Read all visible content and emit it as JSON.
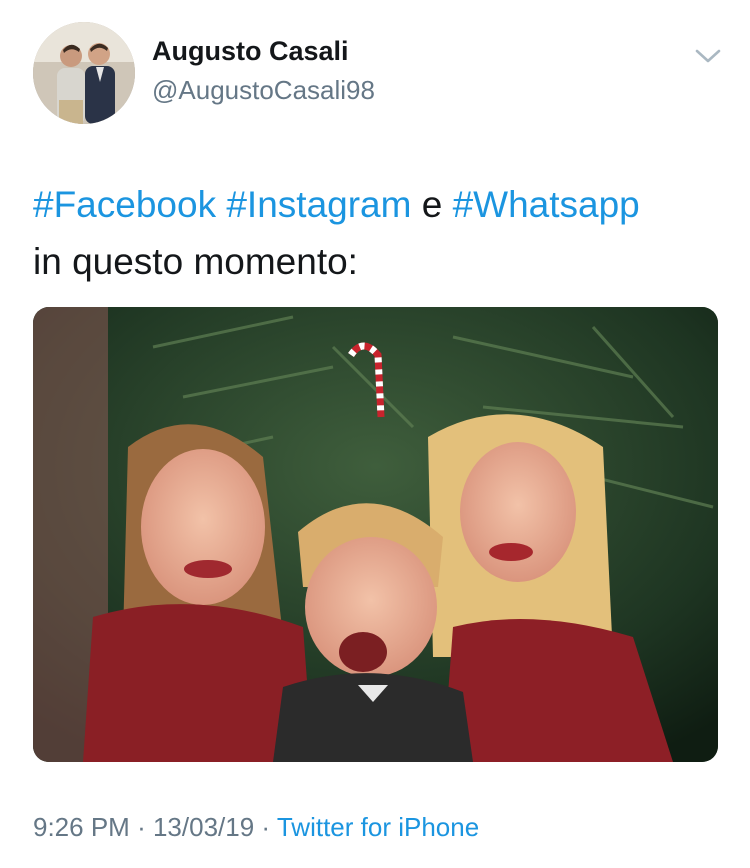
{
  "tweet": {
    "author": {
      "display_name": "Augusto Casali",
      "handle": "@AugustoCasali98"
    },
    "menu_icon": "chevron-down-icon",
    "text": {
      "hashtag_1": "#Facebook",
      "hashtag_2": "#Instagram",
      "connector": "e",
      "hashtag_3": "#Whatsapp",
      "line_2": "in questo momento:"
    },
    "meta": {
      "time": "9:26 PM",
      "separator_1": "·",
      "date": "13/03/19",
      "separator_2": "·",
      "source": "Twitter for iPhone"
    },
    "colors": {
      "link": "#1b95e0",
      "text": "#14171a",
      "secondary": "#657786"
    }
  }
}
